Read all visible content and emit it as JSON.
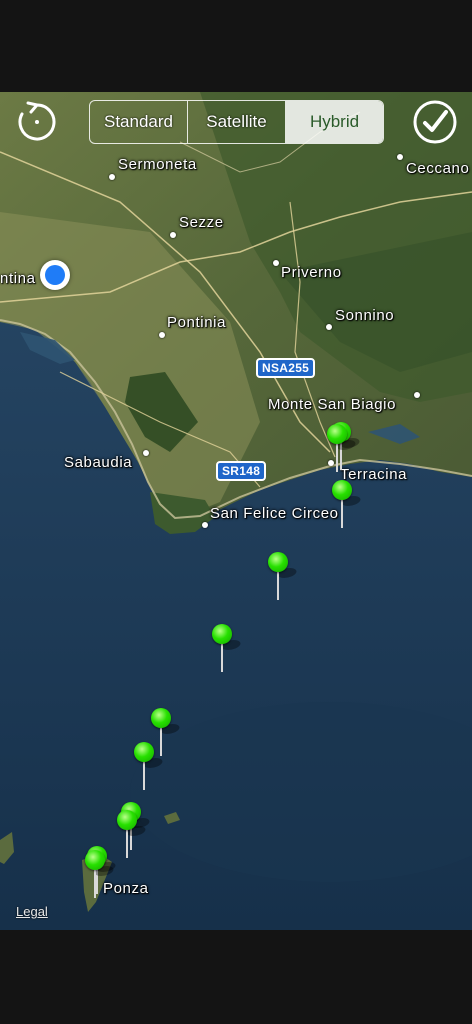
{
  "toolbar": {
    "map_types": [
      "Standard",
      "Satellite",
      "Hybrid"
    ],
    "selected_map_type": "Hybrid",
    "refresh_icon": "refresh-icon",
    "done_icon": "checkmark-icon"
  },
  "map": {
    "places": [
      {
        "name": "Sermoneta"
      },
      {
        "name": "Ceccano"
      },
      {
        "name": "Sezze"
      },
      {
        "name": "ntina"
      },
      {
        "name": "Priverno"
      },
      {
        "name": "Pontinia"
      },
      {
        "name": "Sonnino"
      },
      {
        "name": "Monte San Biagio"
      },
      {
        "name": "Sabaudia"
      },
      {
        "name": "Terracina"
      },
      {
        "name": "San Felice Circeo"
      },
      {
        "name": "Ponza"
      }
    ],
    "road_shields": [
      {
        "label": "NSA255"
      },
      {
        "label": "SR148"
      }
    ],
    "pin_count": 11,
    "pin_color": "#27e000",
    "user_location_color": "#1f7cf7",
    "legal_label": "Legal"
  }
}
